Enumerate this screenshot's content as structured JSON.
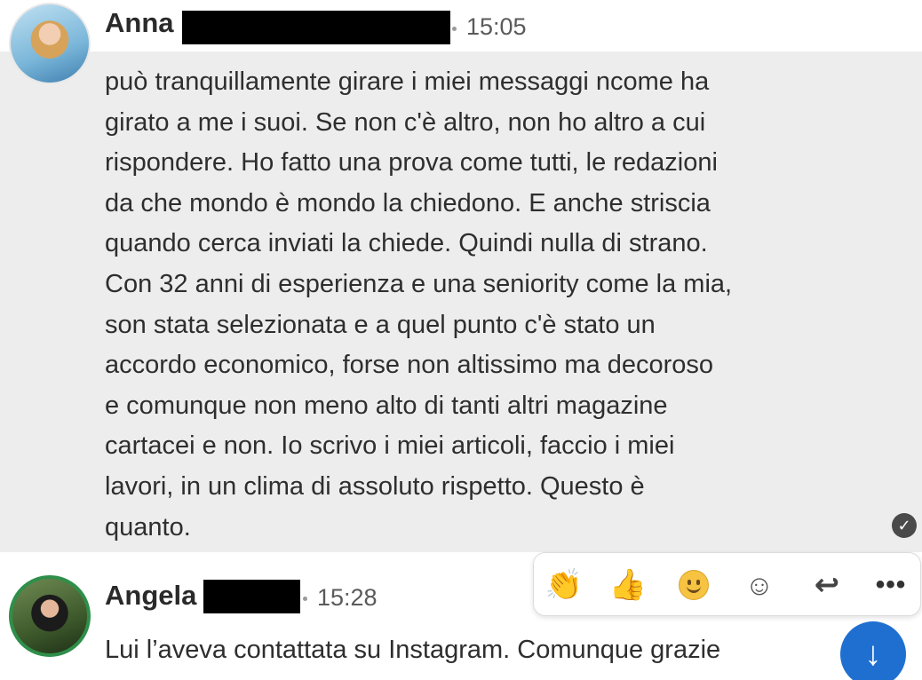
{
  "message1": {
    "sender": "Anna",
    "time": "15:05",
    "lines": [
      "può tranquillamente girare i miei messaggi ncome ha",
      "girato a me i suoi. Se non c'è altro, non ho altro a cui",
      "rispondere. Ho fatto una prova come tutti, le redazioni",
      "da che mondo è mondo la chiedono. E anche striscia",
      "quando cerca inviati la chiede. Quindi nulla di strano.",
      "Con 32 anni di esperienza e una seniority come la mia,",
      "son stata selezionata e a quel punto c'è stato un",
      "accordo economico, forse non altissimo ma decoroso",
      "e comunque non meno alto di tanti altri magazine",
      "cartacei e non. Io scrivo i miei articoli, faccio i miei",
      "lavori, in un clima di assoluto rispetto. Questo è",
      "quanto."
    ],
    "read_icon": "checkmark-icon"
  },
  "message2": {
    "sender": "Angela",
    "time": "15:28",
    "text": "Lui l’aveva contattata su Instagram. Comunque grazie"
  },
  "reaction_bar": {
    "items": [
      "clap-icon",
      "thumbs-up-icon",
      "smile-icon",
      "add-reaction-icon",
      "reply-icon",
      "more-icon"
    ],
    "more_label": "•••"
  },
  "scroll_button": {
    "icon": "arrow-down-icon",
    "label": "↓"
  },
  "colors": {
    "highlight_bg": "#ededed",
    "accent_blue": "#1f6fd1",
    "redaction": "#000000"
  }
}
